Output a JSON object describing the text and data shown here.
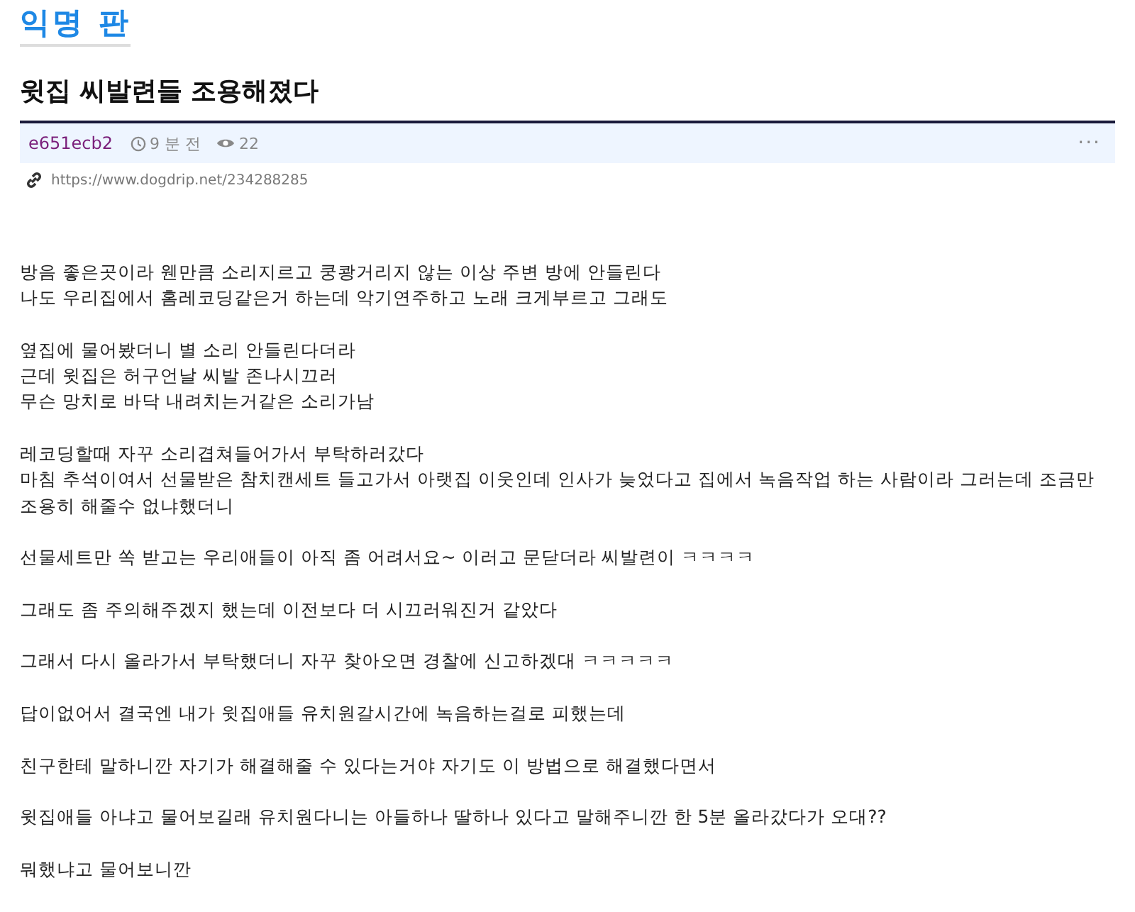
{
  "board_title": "익명 판",
  "post": {
    "title": "윗집 씨발련들 조용해졌다",
    "author": "e651ecb2",
    "time": "9 분 전",
    "views": "22",
    "more": "···",
    "link": "https://www.dogdrip.net/234288285"
  },
  "paragraphs": [
    [
      "방음 좋은곳이라 웬만큼 소리지르고 쿵쾅거리지 않는 이상 주변 방에 안들린다",
      "나도 우리집에서 홈레코딩같은거 하는데 악기연주하고 노래 크게부르고 그래도"
    ],
    [
      "옆집에 물어봤더니 별 소리 안들린다더라",
      "근데 윗집은 허구언날 씨발 존나시끄러",
      "무슨 망치로 바닥 내려치는거같은 소리가남"
    ],
    [
      "레코딩할때 자꾸 소리겹쳐들어가서 부탁하러갔다",
      "마침 추석이여서 선물받은 참치캔세트 들고가서 아랫집 이웃인데 인사가 늦었다고 집에서 녹음작업 하는 사람이라 그러는데 조금만 조용히 해줄수 없냐했더니"
    ],
    [
      "선물세트만 쏙 받고는 우리애들이 아직 좀 어려서요~ 이러고 문닫더라 씨발련이 ㅋㅋㅋㅋ"
    ],
    [
      "그래도 좀 주의해주겠지 했는데 이전보다 더 시끄러워진거 같았다"
    ],
    [
      "그래서 다시 올라가서 부탁했더니 자꾸 찾아오면 경찰에 신고하겠대 ㅋㅋㅋㅋㅋ"
    ],
    [
      "답이없어서 결국엔 내가 윗집애들 유치원갈시간에 녹음하는걸로 피했는데"
    ],
    [
      "친구한테 말하니깐 자기가 해결해줄 수 있다는거야 자기도 이 방법으로 해결했다면서"
    ],
    [
      "윗집애들 아냐고 물어보길래 유치원다니는 아들하나 딸하나 있다고 말해주니깐 한 5분 올라갔다가 오대??"
    ],
    [
      "뭐했냐고 물어보니깐"
    ]
  ]
}
